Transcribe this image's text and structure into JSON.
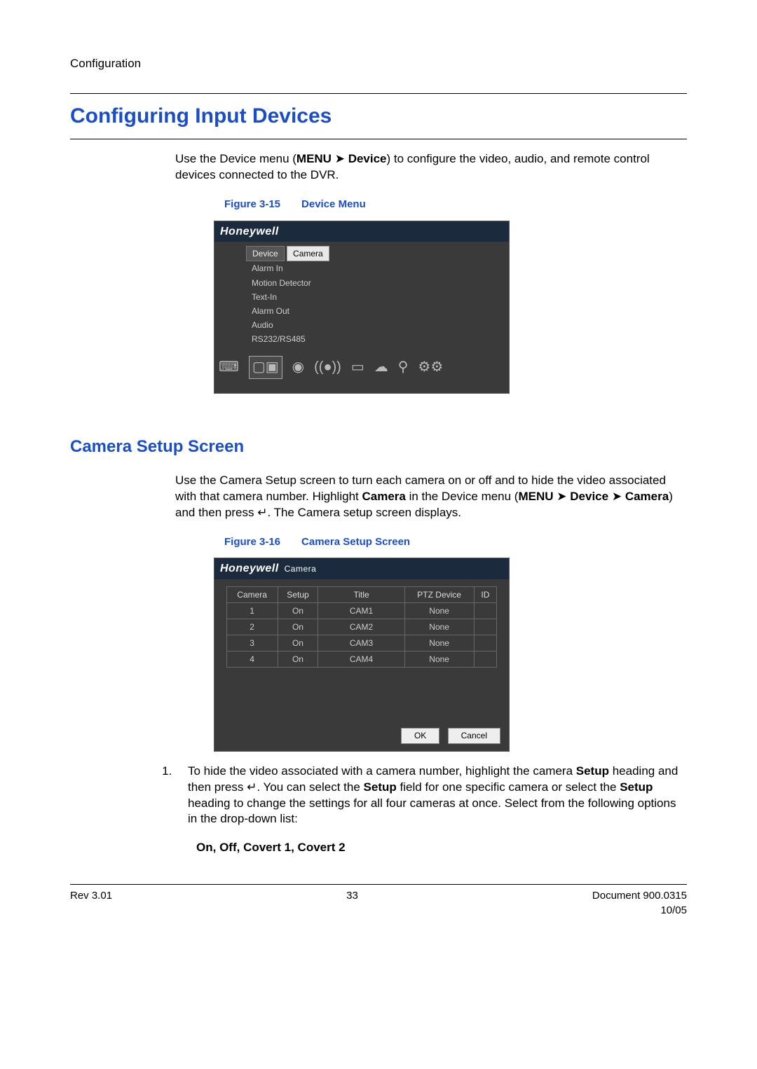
{
  "header": {
    "section": "Configuration"
  },
  "h1": "Configuring Input Devices",
  "para1": {
    "pre": "Use the Device menu (",
    "menu": "MENU",
    "arrow": "➤",
    "device": "Device",
    "post": ") to configure the video, audio, and remote control devices connected to the DVR."
  },
  "fig1": {
    "label": "Figure 3-15",
    "title": "Device Menu"
  },
  "shot1": {
    "brand": "Honeywell",
    "menu_header": "Device",
    "items": [
      "Camera",
      "Alarm In",
      "Motion Detector",
      "Text-In",
      "Alarm Out",
      "Audio",
      "RS232/RS485"
    ]
  },
  "h2": "Camera Setup Screen",
  "para2": {
    "pre": "Use the Camera Setup screen to turn each camera on or off and to hide the video associated with that camera number. Highlight ",
    "camera_bold": "Camera",
    "mid1": " in the Device menu (",
    "menu": "MENU",
    "arrow": "➤",
    "device": "Device",
    "arrow2": "➤",
    "camera2": "Camera",
    "mid2": ") and then press ",
    "enter": "↵",
    "post": ". The Camera setup screen displays."
  },
  "fig2": {
    "label": "Figure 3-16",
    "title": "Camera Setup Screen"
  },
  "shot2": {
    "brand": "Honeywell",
    "subtitle": "Camera",
    "cols": [
      "Camera",
      "Setup",
      "Title",
      "PTZ Device",
      "ID"
    ],
    "rows": [
      {
        "cam": "1",
        "setup": "On",
        "title": "CAM1",
        "ptz": "None",
        "id": ""
      },
      {
        "cam": "2",
        "setup": "On",
        "title": "CAM2",
        "ptz": "None",
        "id": ""
      },
      {
        "cam": "3",
        "setup": "On",
        "title": "CAM3",
        "ptz": "None",
        "id": ""
      },
      {
        "cam": "4",
        "setup": "On",
        "title": "CAM4",
        "ptz": "None",
        "id": ""
      }
    ],
    "ok": "OK",
    "cancel": "Cancel"
  },
  "list1": {
    "pre": "To hide the video associated with a camera number, highlight the camera ",
    "setup1": "Setup",
    "mid1": " heading and then press ",
    "enter": "↵",
    "mid2": ". You can select the ",
    "setup2": "Setup",
    "mid3": " field for one specific camera or select the ",
    "setup3": "Setup",
    "post": " heading to change the settings for all four cameras at once. Select from the following options in the drop-down list:"
  },
  "options_line": {
    "a": "On",
    "b": "Off",
    "c": "Covert 1",
    "d": "Covert 2",
    "sep": ", "
  },
  "footer": {
    "rev": "Rev 3.01",
    "page": "33",
    "doc": "Document 900.0315",
    "date": "10/05"
  }
}
